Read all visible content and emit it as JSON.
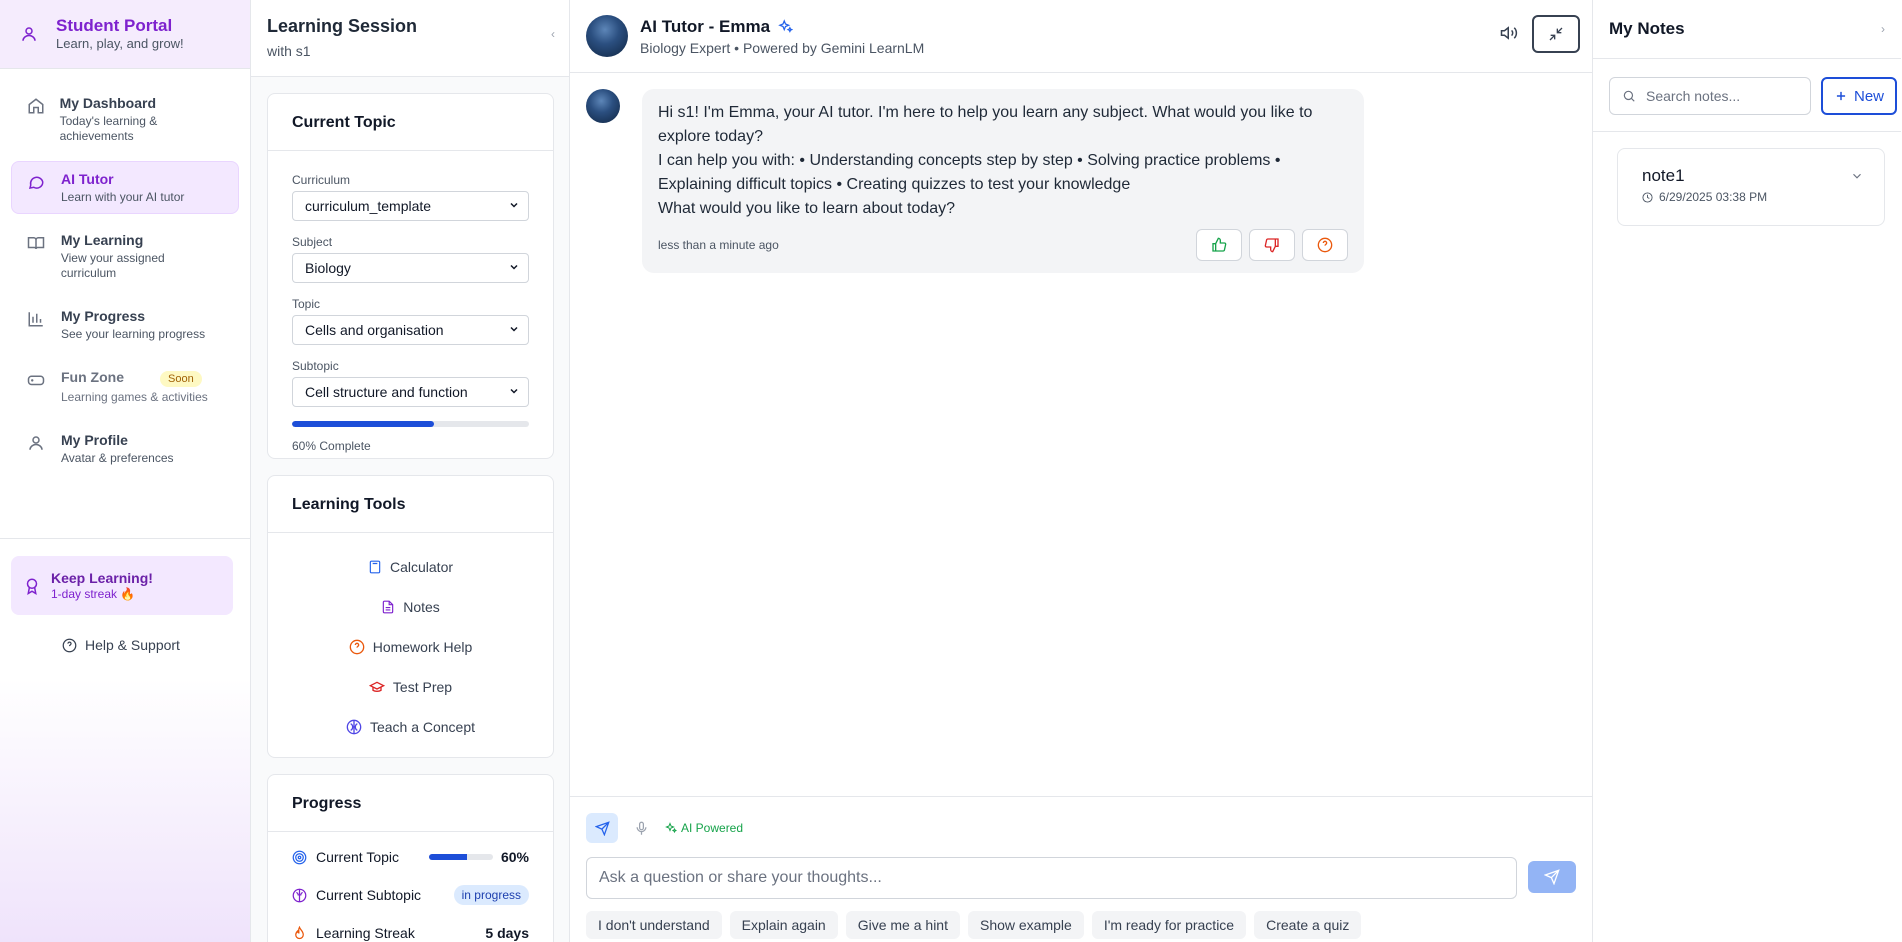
{
  "sidebar": {
    "title": "Student Portal",
    "subtitle": "Learn, play, and grow!",
    "items": [
      {
        "label": "My Dashboard",
        "desc": "Today's learning & achievements"
      },
      {
        "label": "AI Tutor",
        "desc": "Learn with your AI tutor"
      },
      {
        "label": "My Learning",
        "desc": "View your assigned curriculum"
      },
      {
        "label": "My Progress",
        "desc": "See your learning progress"
      },
      {
        "label": "Fun Zone",
        "desc": "Learning games & activities",
        "badge": "Soon"
      },
      {
        "label": "My Profile",
        "desc": "Avatar & preferences"
      }
    ],
    "streak": {
      "title": "Keep Learning!",
      "text": "1-day streak 🔥"
    },
    "help": "Help & Support"
  },
  "session": {
    "title": "Learning Session",
    "subtitle": "with s1",
    "current_topic": {
      "title": "Current Topic",
      "curriculum_label": "Curriculum",
      "curriculum_value": "curriculum_template",
      "subject_label": "Subject",
      "subject_value": "Biology",
      "topic_label": "Topic",
      "topic_value": "Cells and organisation",
      "subtopic_label": "Subtopic",
      "subtopic_value": "Cell structure and function",
      "progress": 0.6,
      "progress_text": "60% Complete"
    },
    "tools": {
      "title": "Learning Tools",
      "items": [
        "Calculator",
        "Notes",
        "Homework Help",
        "Test Prep",
        "Teach a Concept"
      ]
    },
    "progress": {
      "title": "Progress",
      "current_topic_label": "Current Topic",
      "current_topic_value": 0.6,
      "current_topic_pct": "60%",
      "current_subtopic_label": "Current Subtopic",
      "current_subtopic_status": "in progress",
      "streak_label": "Learning Streak",
      "streak_value": "5 days"
    }
  },
  "chat": {
    "name": "AI Tutor - Emma",
    "subtitle": "Biology Expert • Powered by Gemini LearnLM",
    "message": {
      "line1": "Hi s1! I'm Emma, your AI tutor. I'm here to help you learn any subject. What would you like to explore today?",
      "line2": "I can help you with: • Understanding concepts step by step • Solving practice problems • Explaining difficult topics • Creating quizzes to test your knowledge",
      "line3": "What would you like to learn about today?",
      "time": "less than a minute ago"
    },
    "ai_powered": "AI Powered",
    "input_placeholder": "Ask a question or share your thoughts...",
    "chips": [
      "I don't understand",
      "Explain again",
      "Give me a hint",
      "Show example",
      "I'm ready for practice",
      "Create a quiz"
    ],
    "colors": {
      "accent": "#1d4ed8",
      "purple": "#7e22ce",
      "green": "#16a34a"
    }
  },
  "notes": {
    "title": "My Notes",
    "search_placeholder": "Search notes...",
    "new_label": "New",
    "items": [
      {
        "title": "note1",
        "date": "6/29/2025 03:38 PM"
      }
    ]
  }
}
